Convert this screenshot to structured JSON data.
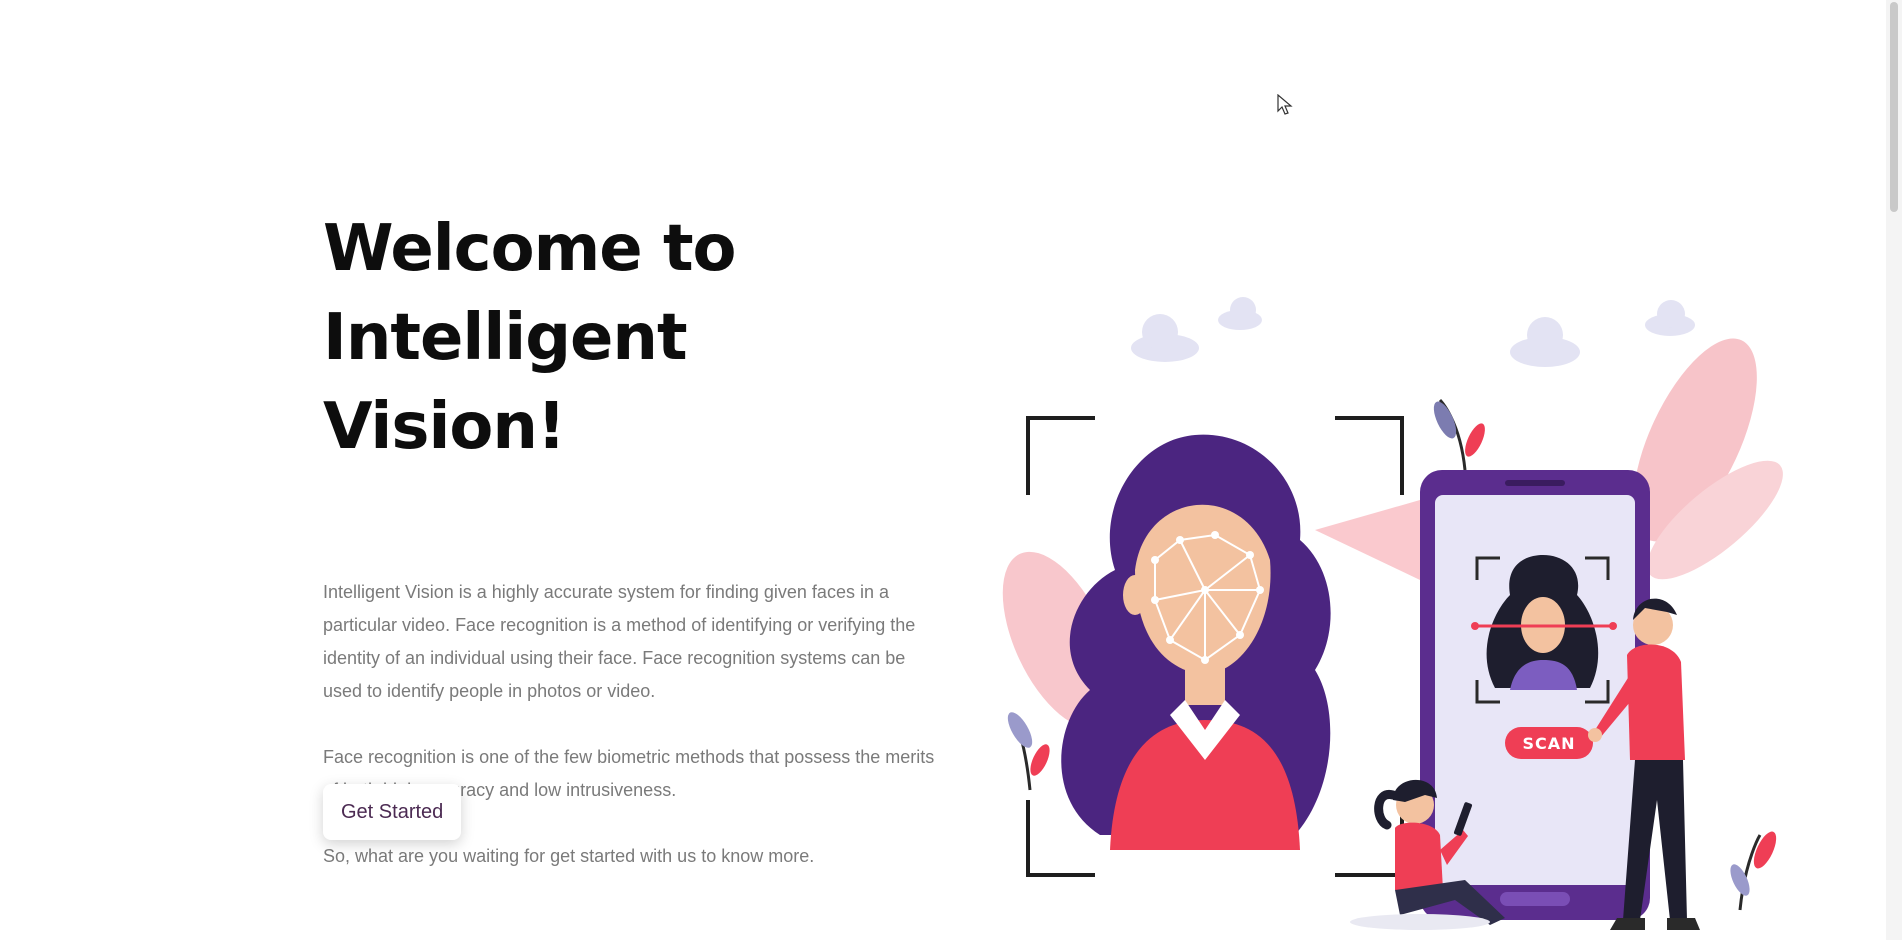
{
  "hero": {
    "title_line1": "Welcome to",
    "title_line2": "Intelligent Vision!",
    "paragraph1": "Intelligent Vision is a highly accurate system for finding given faces in a particular video. Face recognition is a method of identifying or verifying the identity of an individual using their face. Face recognition systems can be used to identify people in photos or video.",
    "paragraph2": "Face recognition is one of the few biometric methods that possess the merits of both high accuracy and low intrusiveness.",
    "paragraph3": "So, what are you waiting for get started with us to know more.",
    "cta_label": "Get Started"
  },
  "illustration": {
    "scan_label": "SCAN"
  },
  "colors": {
    "title": "#0d0d0d",
    "body_text": "#7a7a7a",
    "cta_text": "#4b2a52",
    "purple": "#5b2d8e",
    "red": "#ef3e55",
    "pink": "#f6b8bf"
  }
}
